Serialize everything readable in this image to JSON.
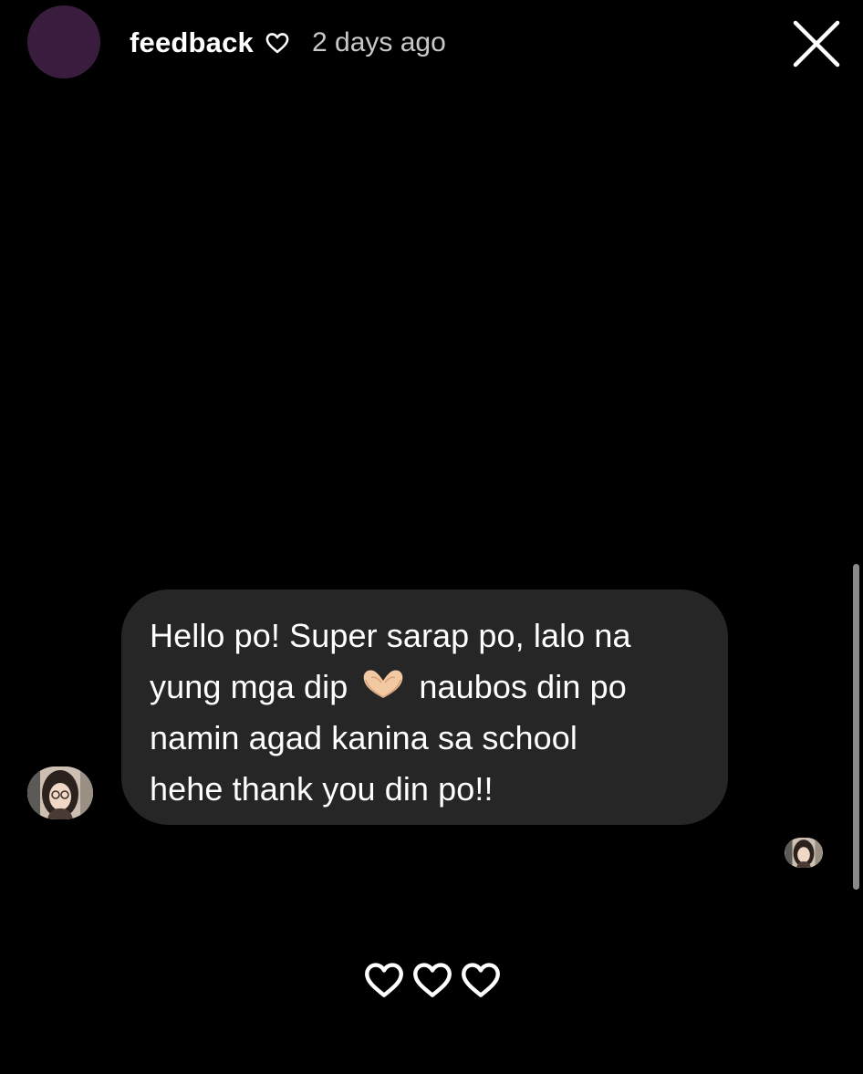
{
  "header": {
    "story_name": "feedback",
    "time_ago": "2 days ago",
    "icons": {
      "heart": "heart-outline-icon",
      "close": "close-icon"
    }
  },
  "message": {
    "lines": [
      "Hello po! Super sarap po, lalo na",
      "yung mga dip",
      "naubos din po",
      "namin agad kanina sa school",
      "hehe thank you din po!!"
    ],
    "emoji": "🫶"
  },
  "reactions": {
    "icons": [
      "heart-outline-icon",
      "heart-outline-icon",
      "heart-outline-icon"
    ]
  },
  "colors": {
    "background": "#000000",
    "bubble": "#262626",
    "avatar": "#3a1d3e",
    "text": "#ffffff",
    "muted_text": "#c9c9c9"
  }
}
